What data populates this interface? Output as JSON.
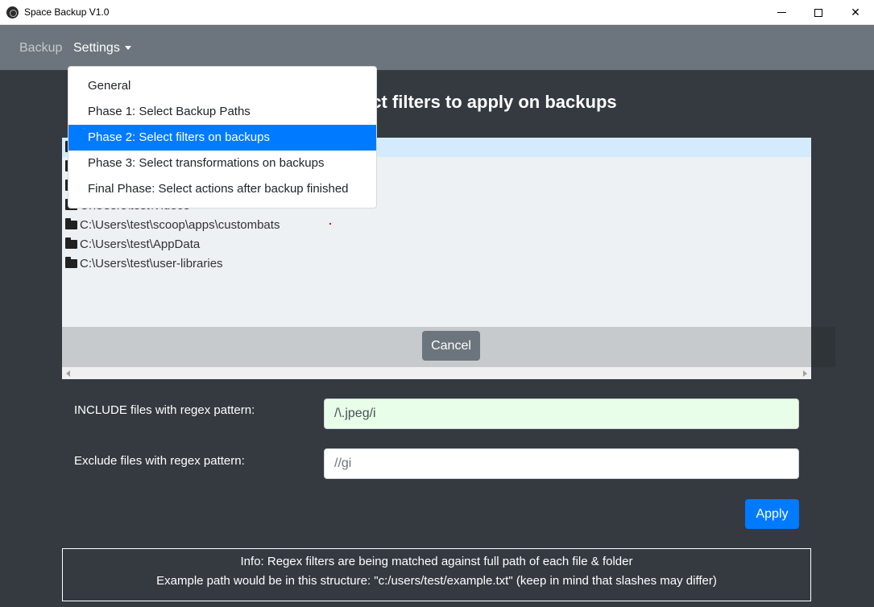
{
  "window": {
    "title": "Space Backup V1.0",
    "controls": {
      "minimize": "",
      "maximize": "",
      "close": "✕"
    }
  },
  "navbar": {
    "backup_label": "Backup",
    "settings_label": "Settings"
  },
  "page": {
    "title": "Phase 2: Select filters to apply on backups",
    "title_visible_fragment": "ers to apply on backups"
  },
  "dropdown": {
    "items": [
      {
        "label": "General",
        "active": false
      },
      {
        "label": "Phase 1: Select Backup Paths",
        "active": false
      },
      {
        "label": "Phase 2: Select filters on backups",
        "active": true
      },
      {
        "label": "Phase 3: Select transformations on backups",
        "active": false
      },
      {
        "label": "Final Phase: Select actions after backup finished",
        "active": false
      }
    ]
  },
  "tree": {
    "rows": [
      {
        "path": "",
        "selected": true
      },
      {
        "path": "",
        "selected": false
      },
      {
        "path": "",
        "selected": false
      },
      {
        "path": "C:\\Users\\test\\Videos",
        "selected": false
      },
      {
        "path": "C:\\Users\\test\\scoop\\apps\\custombats",
        "selected": false
      },
      {
        "path": "C:\\Users\\test\\AppData",
        "selected": false
      },
      {
        "path": "C:\\Users\\test\\user-libraries",
        "selected": false
      }
    ],
    "cancel_label": "Cancel"
  },
  "filters": {
    "include_label": "INCLUDE files with regex pattern:",
    "include_value": "/\\.jpeg/i",
    "exclude_label": "Exclude files with regex pattern:",
    "exclude_value": "//gi",
    "apply_label": "Apply"
  },
  "info": {
    "line1": "Info: Regex filters are being matched against full path of each file & folder",
    "line2": "Example path would be in this structure: \"c:/users/test/example.txt\" (keep in mind that slashes may differ)"
  },
  "colors": {
    "navbar": "#6c757d",
    "background": "#343a40",
    "primary": "#007bff",
    "secondary": "#6c757d",
    "include_input_bg": "#e8fee8"
  }
}
